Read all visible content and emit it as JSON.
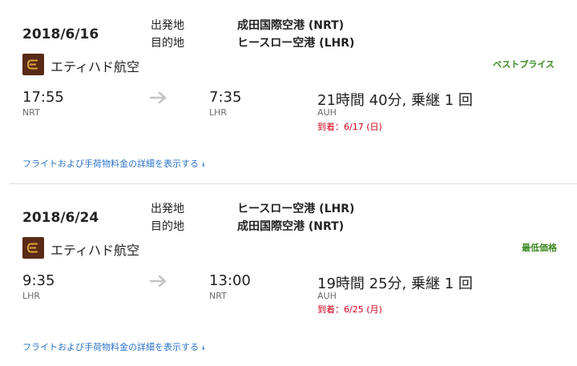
{
  "colors": {
    "brand_logo": "#5a2a16",
    "logo_mark": "#d9a43a",
    "best": "#3a8a1f",
    "link": "#2a72c8",
    "arrive": "#d0021b"
  },
  "flights": [
    {
      "date": "2018/6/16",
      "origin_label": "出発地",
      "dest_label": "目的地",
      "origin": "成田国際空港 (NRT)",
      "destination": "ヒースロー空港 (LHR)",
      "airline": "エティハド航空",
      "badge": "ベストプライス",
      "dep_time": "17:55",
      "dep_code": "NRT",
      "arr_time": "7:35",
      "arr_code": "LHR",
      "duration": "21時間 40分, 乗継 1 回",
      "via": "AUH",
      "arrival_note": "到着：6/17 (日)",
      "details_link": "フライトおよび手荷物料金の詳細を表示する",
      "details_icon": "double-chevron-down"
    },
    {
      "date": "2018/6/24",
      "origin_label": "出発地",
      "dest_label": "目的地",
      "origin": "ヒースロー空港 (LHR)",
      "destination": "成田国際空港 (NRT)",
      "airline": "エティハド航空",
      "badge": "最低価格",
      "dep_time": "9:35",
      "dep_code": "LHR",
      "arr_time": "13:00",
      "arr_code": "NRT",
      "duration": "19時間 25分, 乗継 1 回",
      "via": "AUH",
      "arrival_note": "到着：6/25 (月)",
      "details_link": "フライトおよび手荷物料金の詳細を表示する",
      "details_icon": "double-chevron-down"
    }
  ]
}
